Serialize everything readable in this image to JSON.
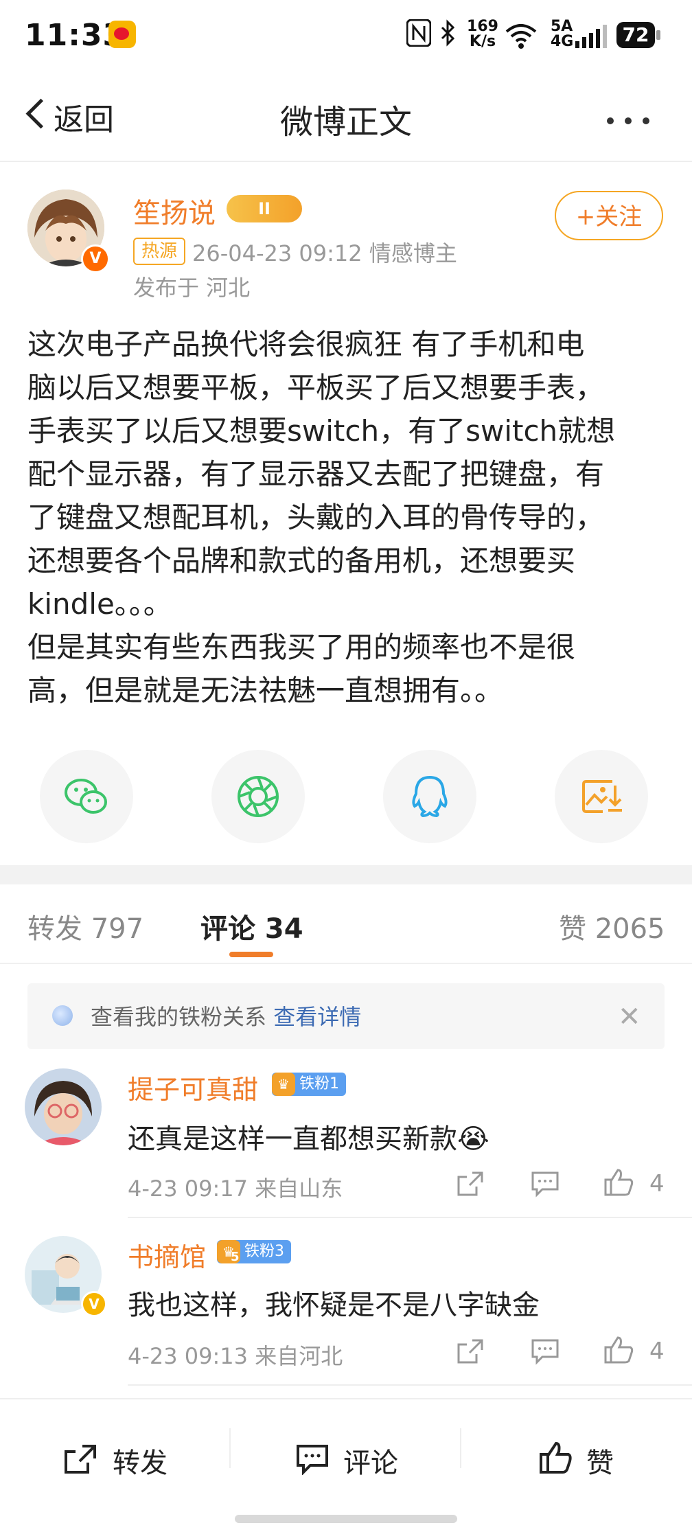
{
  "status_bar": {
    "time": "11:33",
    "net_speed_value": "169",
    "net_speed_unit": "K/s",
    "signal_top": "5A",
    "signal_bottom": "4G",
    "battery": "72"
  },
  "nav": {
    "back_label": "返回",
    "title": "微博正文"
  },
  "author": {
    "name": "笙扬说",
    "vip_level": "II",
    "hot_tag": "热源",
    "meta": "26-04-23 09:12  情感博主",
    "location": "发布于 河北",
    "follow_label": "+关注"
  },
  "post": {
    "lines": [
      "这次电子产品换代将会很疯狂 有了手机和电",
      "脑以后又想要平板，平板买了后又想要手表，",
      "手表买了以后又想要switch，有了switch就想",
      "配个显示器，有了显示器又去配了把键盘，有",
      "了键盘又想配耳机，头戴的入耳的骨传导的，",
      "还想要各个品牌和款式的备用机，还想要买",
      "kindle。。。",
      "但是其实有些东西我买了用的频率也不是很",
      "高，但是就是无法祛魅一直想拥有。。"
    ]
  },
  "share_icons": [
    "wechat-icon",
    "moments-icon",
    "qq-icon",
    "save-image-icon"
  ],
  "tabs": {
    "repost": "转发 797",
    "comment": "评论 34",
    "like": "赞 2065"
  },
  "fan_banner": {
    "text": "查看我的铁粉关系",
    "link": "查看详情"
  },
  "comments": [
    {
      "name": "提子可真甜",
      "fan_level": "铁粉1",
      "text": "还真是这样一直都想买新款😭",
      "meta": "4-23 09:17 来自山东",
      "likes": "4"
    },
    {
      "name": "书摘馆",
      "fan_level": "铁粉3",
      "crown_level": "5",
      "text": "我也这样，我怀疑是不是八字缺金",
      "meta": "4-23 09:13 来自河北",
      "likes": "4"
    }
  ],
  "bottom_bar": {
    "repost": "转发",
    "comment": "评论",
    "like": "赞"
  },
  "colors": {
    "accent_orange": "#f07d2a",
    "link_blue": "#3d6bb3",
    "fan_badge_blue": "#5b9ff0"
  }
}
